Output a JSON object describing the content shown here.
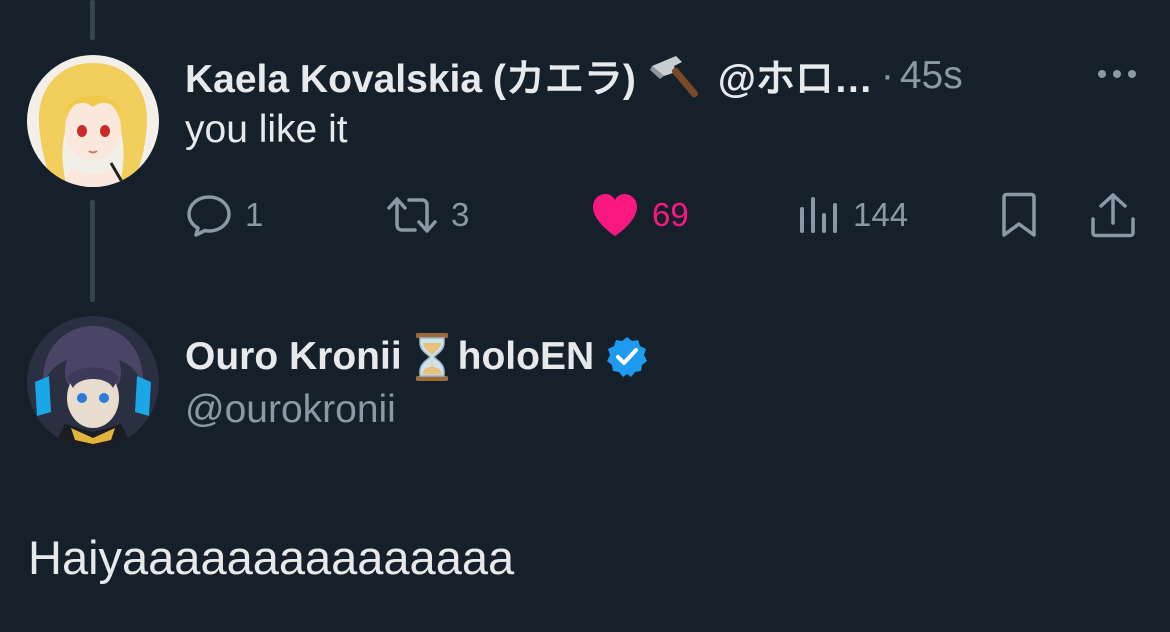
{
  "reply_tweet": {
    "author_name": "Kaela Kovalskia (カエラ)",
    "author_handle": "@ホロ…",
    "separator": "·",
    "time": "45s",
    "text": "you like it",
    "metrics": {
      "replies": "1",
      "retweets": "3",
      "likes": "69",
      "views": "144"
    },
    "liked": true
  },
  "main_tweet": {
    "author_name_part1": "Ouro Kronii",
    "author_name_part2": "holoEN",
    "author_handle": "@ourokronii",
    "verified": true,
    "text": "Haiyaaaaaaaaaaaaaaa"
  },
  "icons": {
    "name_emoji_1": "hammer-icon",
    "name_emoji_2": "hourglass-icon",
    "more": "more-icon",
    "reply": "reply-icon",
    "retweet": "retweet-icon",
    "like": "heart-icon",
    "views": "views-icon",
    "bookmark": "bookmark-icon",
    "share": "share-icon",
    "verified": "verified-badge-icon"
  },
  "colors": {
    "background": "#15202b",
    "text": "#e7e9ea",
    "secondary_text": "#8b98a5",
    "like": "#f91880",
    "verified": "#1d9bf0",
    "thread_line": "#38444d"
  }
}
